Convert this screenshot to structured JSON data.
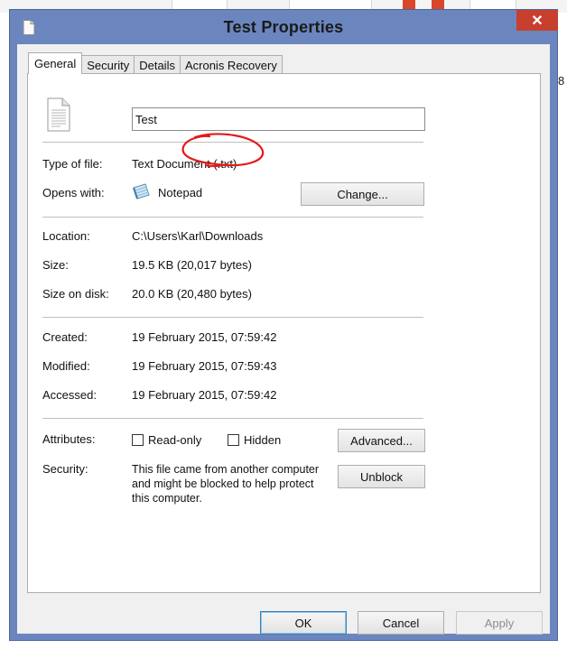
{
  "window": {
    "title": "Test Properties",
    "close_glyph": "✕"
  },
  "tabs": [
    {
      "label": "General",
      "active": true
    },
    {
      "label": "Security",
      "active": false
    },
    {
      "label": "Details",
      "active": false
    },
    {
      "label": "Acronis Recovery",
      "active": false
    }
  ],
  "general": {
    "file_name": "Test",
    "type_label": "Type of file:",
    "type_value": "Text Document (.txt)",
    "opens_label": "Opens with:",
    "opens_value": "Notepad",
    "change_button": "Change...",
    "location_label": "Location:",
    "location_value": "C:\\Users\\Karl\\Downloads",
    "size_label": "Size:",
    "size_value": "19.5 KB (20,017 bytes)",
    "size_on_disk_label": "Size on disk:",
    "size_on_disk_value": "20.0 KB (20,480 bytes)",
    "created_label": "Created:",
    "created_value": "19 February 2015, 07:59:42",
    "modified_label": "Modified:",
    "modified_value": "19 February 2015, 07:59:43",
    "accessed_label": "Accessed:",
    "accessed_value": "19 February 2015, 07:59:42",
    "attributes_label": "Attributes:",
    "readonly_label": "Read-only",
    "readonly_checked": false,
    "hidden_label": "Hidden",
    "hidden_checked": false,
    "advanced_button": "Advanced...",
    "security_label": "Security:",
    "security_line1": "This file came from another computer",
    "security_line2": "and might be blocked to help protect",
    "security_line3": "this computer.",
    "unblock_button": "Unblock"
  },
  "footer": {
    "ok": "OK",
    "cancel": "Cancel",
    "apply": "Apply"
  },
  "background": {
    "right_edge_text": "8"
  },
  "colors": {
    "window_frame": "#6b86bf",
    "close_button": "#c7402e",
    "annotation": "#e21b1b"
  },
  "icons": {
    "title": "document-icon",
    "file": "text-file-icon",
    "app": "notepad-icon"
  }
}
